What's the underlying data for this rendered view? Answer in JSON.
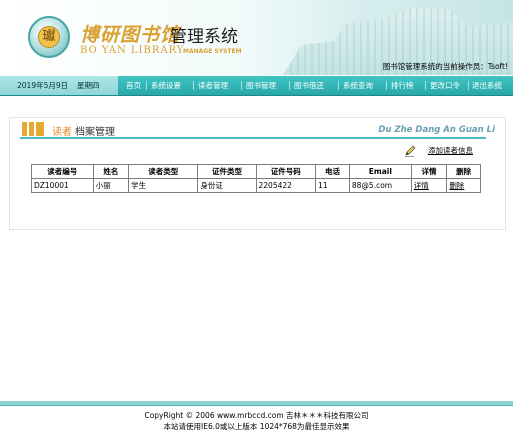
{
  "header": {
    "logo_char": "瓛",
    "brand_cn": "博研图书馆",
    "brand_system": "管理系统",
    "brand_en": "BO YAN LIBRARY",
    "brand_manage": "MANAGE SYSTEM",
    "operator_text": "图书馆管理系统的当前操作员：Tsoft!"
  },
  "navbar": {
    "date": "2019年5月9日",
    "weekday": "星期四",
    "items": [
      "首页",
      "系统设置",
      "读者管理",
      "图书管理",
      "图书借还",
      "系统查询",
      "排行榜",
      "更改口令",
      "退出系统"
    ]
  },
  "panel": {
    "title_part1": "读者",
    "title_part2": "档案管理",
    "title_en": "Du Zhe Dang An Guan Li",
    "add_link": "添加读者信息"
  },
  "table": {
    "headers": [
      "读者编号",
      "姓名",
      "读者类型",
      "证件类型",
      "证件号码",
      "电话",
      "Email",
      "详情",
      "删除"
    ],
    "rows": [
      [
        "DZ10001",
        "小丽",
        "学生",
        "身份证",
        "2205422",
        "11",
        "88@5.com",
        "详情",
        "删除"
      ]
    ]
  },
  "footer": {
    "line1": "CopyRight © 2006 www.mrbccd.com 吉林＊＊＊科技有限公司",
    "line2": "本站请使用IE6.0或以上版本 1024*768为最佳显示效果"
  },
  "colors": {
    "nav_bg": "#2aa8a8",
    "accent_orange": "#e08a2a",
    "brand_gold": "#d9a233",
    "title_line": "#49b9c4"
  }
}
